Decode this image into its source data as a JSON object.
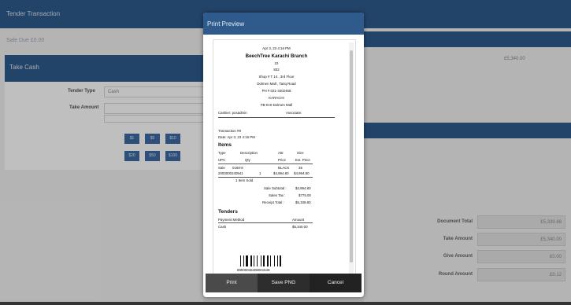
{
  "background": {
    "title": "Tender Transaction",
    "sale_due": "Sale Due £0.00",
    "take_cash": "Take Cash",
    "tender_type_label": "Tender Type",
    "tender_type_value": "Cash",
    "take_amount_label": "Take Amount",
    "cash_buttons": [
      "$1",
      "$5",
      "$10",
      "$20",
      "$50",
      "$100"
    ],
    "right_top_amount": "£5,340.00",
    "totals": [
      {
        "label": "Document Total",
        "value": "£5,339.88"
      },
      {
        "label": "Take Amount",
        "value": "£5,340.00"
      },
      {
        "label": "Give Amount",
        "value": "£0.00"
      },
      {
        "label": "Round Amount",
        "value": "£0.12"
      }
    ]
  },
  "dialog": {
    "title": "Print Preview",
    "buttons": {
      "print": "Print",
      "save_png": "Save PNG",
      "cancel": "Cancel"
    }
  },
  "receipt": {
    "datetime": "Apr 3, 23 4:16 PM",
    "store": "BeechTree Karachi Branch",
    "addr1": "22",
    "addr2": "832",
    "addr3": "Shop # T 14 , 3rd Floor",
    "addr4": "Dolmen Mall , Tariq Road",
    "phone": "PH # 021-3402468",
    "city": "KARACHI",
    "mall": "FB-KHI-Dolmen Mall",
    "cashier": "Cashier: posadmin",
    "associate": "Associate:",
    "transaction": "Transaction #8",
    "date": "Date: Apr 3, 23 4:16 PM",
    "items_heading": "Items",
    "items_header1": [
      "Type",
      "Description",
      "Attr",
      "Size"
    ],
    "items_header2": [
      "UPC",
      "Qty",
      "Price",
      "Ext. Price"
    ],
    "item_row1": [
      "Sale",
      "0168-8",
      "BLACK",
      "35"
    ],
    "item_row2": [
      "2000000240941",
      "1",
      "$4,994.80",
      "$4,994.80"
    ],
    "item_sold": "1 Item Sold",
    "subtotal_label": "Sale Subtotal :",
    "subtotal_value": "$4,994.80",
    "tax_label": "Sales Tax :",
    "tax_value": "$775.00",
    "receipt_total_label": "Receipt Total :",
    "receipt_total_value": "$5,339.80",
    "tenders_heading": "Tenders",
    "payment_method_label": "Payment Method",
    "amount_label": "Amount",
    "cash_label": "Cash",
    "cash_value": "$5,340.00",
    "barcode_number": "89000046408001548"
  }
}
